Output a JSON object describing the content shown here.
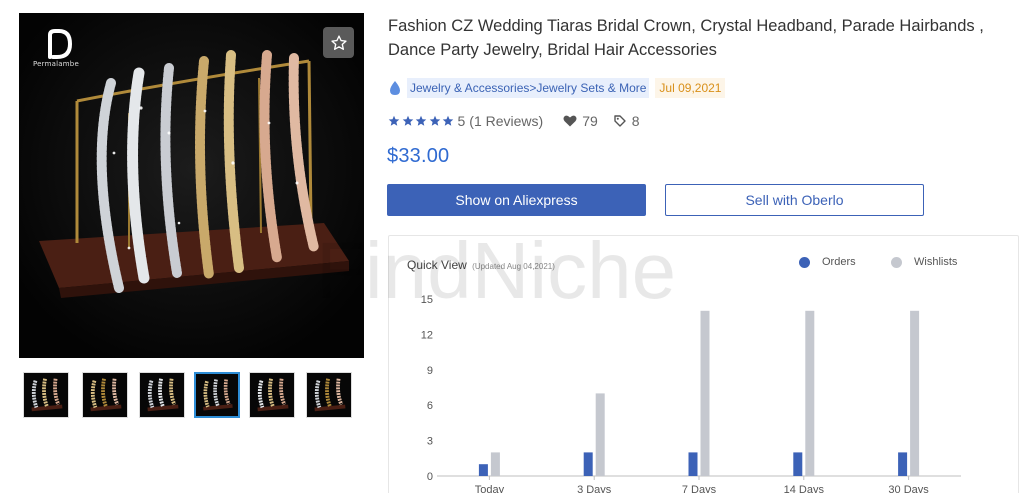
{
  "product": {
    "title": "Fashion CZ Wedding Tiaras Bridal Crown, Crystal Headband, Parade Hairbands , Dance Party Jewelry, Bridal Hair Accessories",
    "brand_logo_text": "Permalambe",
    "category": "Jewelry & Accessories>Jewelry Sets & More",
    "date": "Jul 09,2021",
    "rating": "5",
    "reviews": "(1 Reviews)",
    "likes": "79",
    "tags": "8",
    "price": "$33.00"
  },
  "gallery": {
    "thumbnails": [
      {
        "active": false
      },
      {
        "active": false
      },
      {
        "active": false
      },
      {
        "active": true
      },
      {
        "active": false
      },
      {
        "active": false
      }
    ]
  },
  "buttons": {
    "aliexpress": "Show on Aliexpress",
    "oberlo": "Sell with Oberlo"
  },
  "chart_panel": {
    "title": "Quick View",
    "updated": "(Updated Aug 04,2021)",
    "legend_orders": "Orders",
    "legend_wishlists": "Wishlists"
  },
  "watermark": "FindNiche",
  "colors": {
    "accent": "#3c62b7",
    "price": "#2f6ad1",
    "orders": "#3c62b7",
    "wishlists": "#c5c8cf",
    "category_bg": "#e8effc",
    "date": "#d9901a"
  },
  "icons": [
    "favorite-star-icon",
    "drop-icon",
    "rating-star-icon",
    "heart-icon",
    "tag-icon"
  ],
  "chart_data": {
    "type": "bar",
    "categories": [
      "Today",
      "3 Days",
      "7 Days",
      "14 Days",
      "30 Days"
    ],
    "series": [
      {
        "name": "Orders",
        "values": [
          1,
          2,
          2,
          2,
          2
        ],
        "color": "#3c62b7"
      },
      {
        "name": "Wishlists",
        "values": [
          2,
          7,
          14,
          14,
          14
        ],
        "color": "#c5c8cf"
      }
    ],
    "yticks": [
      0,
      3,
      6,
      9,
      12,
      15
    ],
    "ylim": [
      0,
      15
    ],
    "title": "Quick View",
    "subtitle": "(Updated Aug 04,2021)",
    "legend": "top-right",
    "grid": false
  }
}
